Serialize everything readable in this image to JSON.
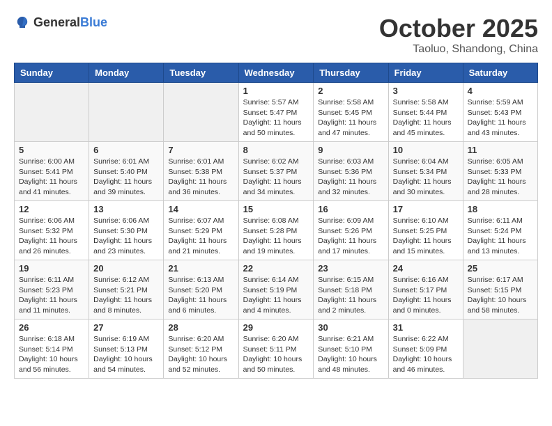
{
  "header": {
    "logo_general": "General",
    "logo_blue": "Blue",
    "title": "October 2025",
    "subtitle": "Taoluo, Shandong, China"
  },
  "days_of_week": [
    "Sunday",
    "Monday",
    "Tuesday",
    "Wednesday",
    "Thursday",
    "Friday",
    "Saturday"
  ],
  "weeks": [
    [
      {
        "day": "",
        "info": ""
      },
      {
        "day": "",
        "info": ""
      },
      {
        "day": "",
        "info": ""
      },
      {
        "day": "1",
        "info": "Sunrise: 5:57 AM\nSunset: 5:47 PM\nDaylight: 11 hours and 50 minutes."
      },
      {
        "day": "2",
        "info": "Sunrise: 5:58 AM\nSunset: 5:45 PM\nDaylight: 11 hours and 47 minutes."
      },
      {
        "day": "3",
        "info": "Sunrise: 5:58 AM\nSunset: 5:44 PM\nDaylight: 11 hours and 45 minutes."
      },
      {
        "day": "4",
        "info": "Sunrise: 5:59 AM\nSunset: 5:43 PM\nDaylight: 11 hours and 43 minutes."
      }
    ],
    [
      {
        "day": "5",
        "info": "Sunrise: 6:00 AM\nSunset: 5:41 PM\nDaylight: 11 hours and 41 minutes."
      },
      {
        "day": "6",
        "info": "Sunrise: 6:01 AM\nSunset: 5:40 PM\nDaylight: 11 hours and 39 minutes."
      },
      {
        "day": "7",
        "info": "Sunrise: 6:01 AM\nSunset: 5:38 PM\nDaylight: 11 hours and 36 minutes."
      },
      {
        "day": "8",
        "info": "Sunrise: 6:02 AM\nSunset: 5:37 PM\nDaylight: 11 hours and 34 minutes."
      },
      {
        "day": "9",
        "info": "Sunrise: 6:03 AM\nSunset: 5:36 PM\nDaylight: 11 hours and 32 minutes."
      },
      {
        "day": "10",
        "info": "Sunrise: 6:04 AM\nSunset: 5:34 PM\nDaylight: 11 hours and 30 minutes."
      },
      {
        "day": "11",
        "info": "Sunrise: 6:05 AM\nSunset: 5:33 PM\nDaylight: 11 hours and 28 minutes."
      }
    ],
    [
      {
        "day": "12",
        "info": "Sunrise: 6:06 AM\nSunset: 5:32 PM\nDaylight: 11 hours and 26 minutes."
      },
      {
        "day": "13",
        "info": "Sunrise: 6:06 AM\nSunset: 5:30 PM\nDaylight: 11 hours and 23 minutes."
      },
      {
        "day": "14",
        "info": "Sunrise: 6:07 AM\nSunset: 5:29 PM\nDaylight: 11 hours and 21 minutes."
      },
      {
        "day": "15",
        "info": "Sunrise: 6:08 AM\nSunset: 5:28 PM\nDaylight: 11 hours and 19 minutes."
      },
      {
        "day": "16",
        "info": "Sunrise: 6:09 AM\nSunset: 5:26 PM\nDaylight: 11 hours and 17 minutes."
      },
      {
        "day": "17",
        "info": "Sunrise: 6:10 AM\nSunset: 5:25 PM\nDaylight: 11 hours and 15 minutes."
      },
      {
        "day": "18",
        "info": "Sunrise: 6:11 AM\nSunset: 5:24 PM\nDaylight: 11 hours and 13 minutes."
      }
    ],
    [
      {
        "day": "19",
        "info": "Sunrise: 6:11 AM\nSunset: 5:23 PM\nDaylight: 11 hours and 11 minutes."
      },
      {
        "day": "20",
        "info": "Sunrise: 6:12 AM\nSunset: 5:21 PM\nDaylight: 11 hours and 8 minutes."
      },
      {
        "day": "21",
        "info": "Sunrise: 6:13 AM\nSunset: 5:20 PM\nDaylight: 11 hours and 6 minutes."
      },
      {
        "day": "22",
        "info": "Sunrise: 6:14 AM\nSunset: 5:19 PM\nDaylight: 11 hours and 4 minutes."
      },
      {
        "day": "23",
        "info": "Sunrise: 6:15 AM\nSunset: 5:18 PM\nDaylight: 11 hours and 2 minutes."
      },
      {
        "day": "24",
        "info": "Sunrise: 6:16 AM\nSunset: 5:17 PM\nDaylight: 11 hours and 0 minutes."
      },
      {
        "day": "25",
        "info": "Sunrise: 6:17 AM\nSunset: 5:15 PM\nDaylight: 10 hours and 58 minutes."
      }
    ],
    [
      {
        "day": "26",
        "info": "Sunrise: 6:18 AM\nSunset: 5:14 PM\nDaylight: 10 hours and 56 minutes."
      },
      {
        "day": "27",
        "info": "Sunrise: 6:19 AM\nSunset: 5:13 PM\nDaylight: 10 hours and 54 minutes."
      },
      {
        "day": "28",
        "info": "Sunrise: 6:20 AM\nSunset: 5:12 PM\nDaylight: 10 hours and 52 minutes."
      },
      {
        "day": "29",
        "info": "Sunrise: 6:20 AM\nSunset: 5:11 PM\nDaylight: 10 hours and 50 minutes."
      },
      {
        "day": "30",
        "info": "Sunrise: 6:21 AM\nSunset: 5:10 PM\nDaylight: 10 hours and 48 minutes."
      },
      {
        "day": "31",
        "info": "Sunrise: 6:22 AM\nSunset: 5:09 PM\nDaylight: 10 hours and 46 minutes."
      },
      {
        "day": "",
        "info": ""
      }
    ]
  ]
}
